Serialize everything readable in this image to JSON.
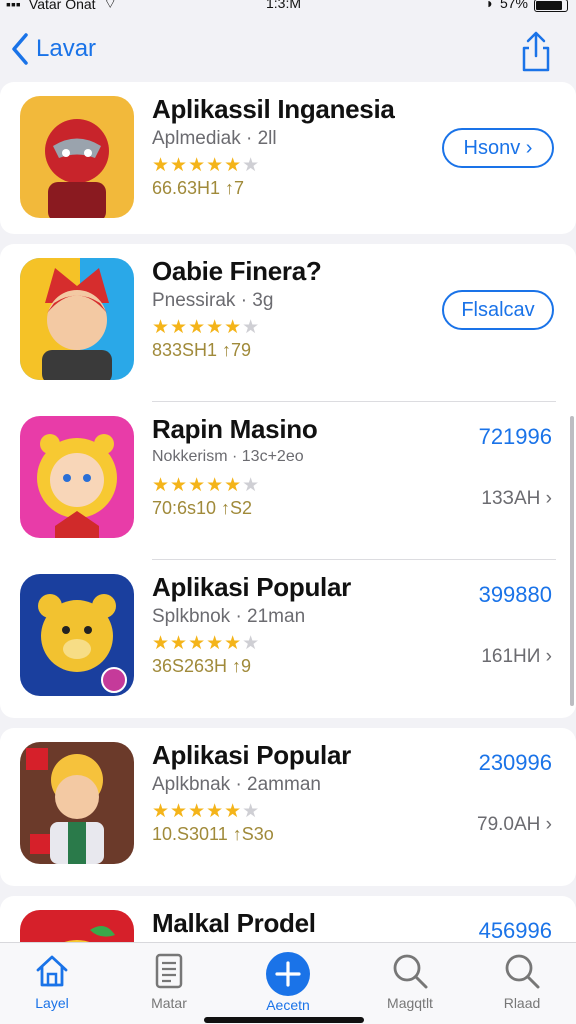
{
  "status": {
    "carrier": "Vatar Onat",
    "time": "1:3:M",
    "battery": "57%"
  },
  "nav": {
    "back_label": "Lavar"
  },
  "apps": [
    {
      "title": "Aplikassil Inganesia",
      "subtitle": "Aplmediak · 2ll",
      "rating_count": "66.63H1 ↑7",
      "action": "Hsonv ›",
      "price": "",
      "size": "",
      "icon_colors": [
        "#f2b93b",
        "#c8242b"
      ]
    },
    {
      "title": "Oabie Finera?",
      "subtitle": "Pnessirak · 3g",
      "rating_count": "833SH1 ↑79",
      "action": "Flsalcav",
      "price": "",
      "size": "",
      "icon_colors": [
        "#2aa8e8",
        "#d62d2d"
      ]
    },
    {
      "title": "Rapin Masino",
      "subtitle": "Nokkerism · 13c+2eo",
      "rating_count": "70:6s10 ↑S2",
      "action": "",
      "price": "721996",
      "size": "13ЗАН ›",
      "icon_colors": [
        "#e83ca8",
        "#f7c932"
      ]
    },
    {
      "title": "Aplikasi Popular",
      "subtitle": "Splkbnok · 21man",
      "rating_count": "36S263H ↑9",
      "action": "",
      "price": "399880",
      "size": "161НИ ›",
      "icon_colors": [
        "#1a3f9e",
        "#f2c230"
      ]
    },
    {
      "title": "Aplikasi Popular",
      "subtitle": "Aplkbnak · 2amman",
      "rating_count": "10.S3011 ↑S3o",
      "action": "",
      "price": "230996",
      "size": "79.0АН ›",
      "icon_colors": [
        "#6b3a2a",
        "#f6c23c"
      ]
    },
    {
      "title": "Malkal Prodel",
      "subtitle": "",
      "rating_count": "",
      "action": "",
      "price": "456996",
      "size": "",
      "icon_colors": [
        "#d6202a",
        "#f7c932"
      ]
    }
  ],
  "tabs": [
    {
      "label": "Layel",
      "icon": "home-icon",
      "active": true
    },
    {
      "label": "Matar",
      "icon": "document-icon",
      "active": false
    },
    {
      "label": "Aecetn",
      "icon": "plus-icon",
      "active": false
    },
    {
      "label": "Magqtlt",
      "icon": "search-icon",
      "active": false
    },
    {
      "label": "Rlaad",
      "icon": "search-icon",
      "active": false
    }
  ],
  "colors": {
    "accent": "#1a73e8",
    "star": "#f4b41a"
  }
}
